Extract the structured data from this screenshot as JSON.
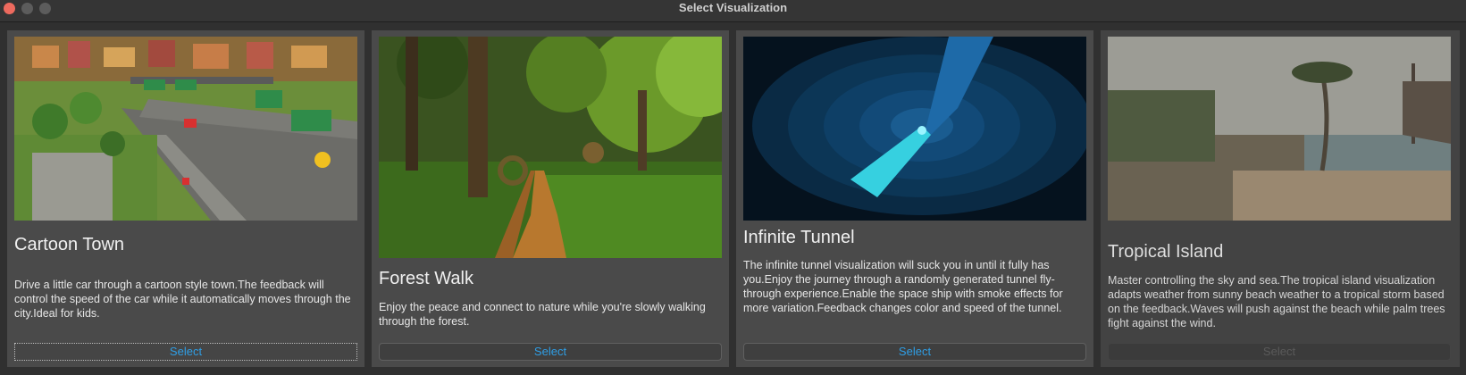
{
  "window": {
    "title": "Select Visualization"
  },
  "cards": [
    {
      "title": "Cartoon Town",
      "description": "Drive a little car through a cartoon style town.The feedback will control the speed of the car while it automatically moves through the city.Ideal for kids.",
      "button_label": "Select",
      "button_state": "focused",
      "image_alt": "cartoon town scene"
    },
    {
      "title": "Forest Walk",
      "description": "Enjoy the peace and connect to nature while you're slowly walking through the forest.",
      "button_label": "Select",
      "button_state": "enabled",
      "image_alt": "forest path scene"
    },
    {
      "title": "Infinite Tunnel",
      "description": "The infinite tunnel visualization will suck you in until it fully has you.Enjoy the journey through a randomly generated tunnel fly-through experience.Enable the space ship with smoke effects for more variation.Feedback changes color and speed of the tunnel.",
      "button_label": "Select",
      "button_state": "enabled",
      "image_alt": "blue tunnel scene"
    },
    {
      "title": "Tropical Island",
      "description": "Master controlling the sky and sea.The tropical island visualization adapts weather from sunny beach weather to a tropical storm based on the feedback.Waves will push against the beach while palm trees fight against the wind.",
      "button_label": "Select",
      "button_state": "disabled",
      "image_alt": "tropical beach scene"
    }
  ],
  "colors": {
    "accent": "#2f9ee5",
    "card_bg": "#4a4a4a",
    "window_bg": "#303030"
  }
}
